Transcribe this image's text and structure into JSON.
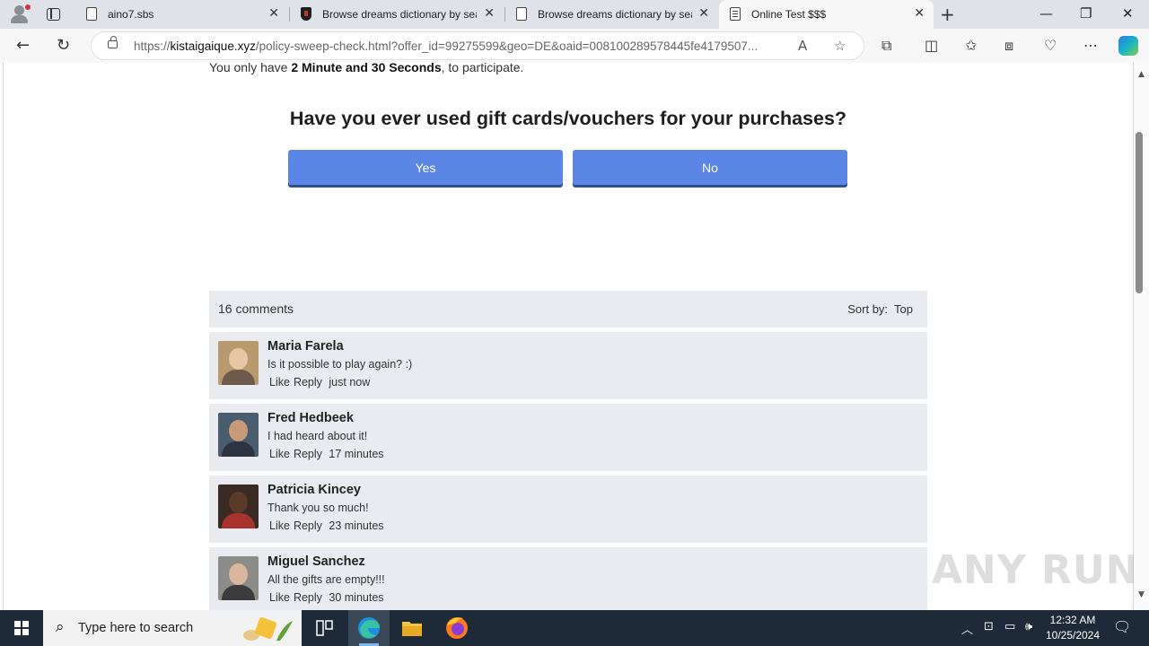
{
  "browser": {
    "tabs": [
      {
        "title": "aino7.sbs"
      },
      {
        "title": "Browse dreams dictionary by sea"
      },
      {
        "title": "Browse dreams dictionary by sea"
      },
      {
        "title": "Online Test $$$"
      }
    ],
    "url_host": "kistaigaique.xyz",
    "url_prefix": "https://",
    "url_rest": "/policy-sweep-check.html?offer_id=99275599&geo=DE&oaid=008100289578445fe4179507..."
  },
  "page": {
    "timer_prefix": "You only have ",
    "timer_value": "2 Minute and 30 Seconds",
    "timer_suffix": ", to participate.",
    "question": "Have you ever used gift cards/vouchers for your purchases?",
    "answers": {
      "yes": "Yes",
      "no": "No"
    },
    "comments_count": "16 comments",
    "sort_label": "Sort by:",
    "sort_value": "Top",
    "comments": [
      {
        "name": "Maria Farela",
        "text": "Is it possible to play again? :)",
        "like": "Like",
        "reply": "Reply",
        "time": "just now"
      },
      {
        "name": "Fred Hedbeek",
        "text": "I had heard about it!",
        "like": "Like",
        "reply": "Reply",
        "time": "17 minutes"
      },
      {
        "name": "Patricia Kincey",
        "text": "Thank you so much!",
        "like": "Like",
        "reply": "Reply",
        "time": "23 minutes"
      },
      {
        "name": "Miguel Sanchez",
        "text": "All the gifts are empty!!!",
        "like": "Like",
        "reply": "Reply",
        "time": "30 minutes"
      }
    ],
    "watermark": "ANY RUN"
  },
  "taskbar": {
    "search_placeholder": "Type here to search",
    "time": "12:32 AM",
    "date": "10/25/2024"
  },
  "colors": {
    "answer_button": "#5b86e5",
    "comment_bg": "#e9ebf0",
    "taskbar": "#1e2a38"
  }
}
